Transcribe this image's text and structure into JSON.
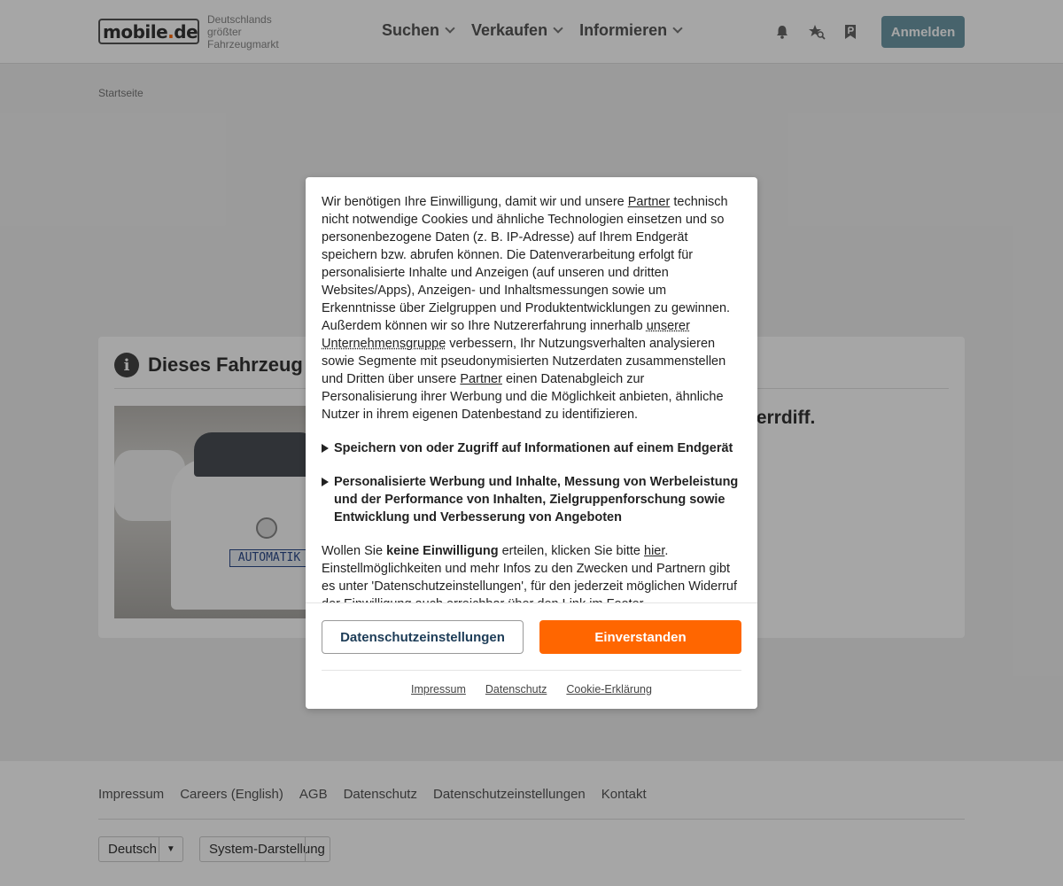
{
  "header": {
    "logo_text": "mobile",
    "logo_dot": ".",
    "logo_tld": "de",
    "slogan": "Deutschlands größter Fahrzeugmarkt",
    "nav": [
      {
        "label": "Suchen"
      },
      {
        "label": "Verkaufen"
      },
      {
        "label": "Informieren"
      }
    ],
    "login_label": "Anmelden",
    "accent_color": "#ff6600"
  },
  "breadcrumb": {
    "home": "Startseite"
  },
  "card": {
    "title": "Dieses Fahrzeug is",
    "model_fragment": "perrdiff.",
    "plate_text": "AUTOMATIK"
  },
  "footer": {
    "links": [
      "Impressum",
      "Careers (English)",
      "AGB",
      "Datenschutz",
      "Datenschutzeinstellungen",
      "Kontakt"
    ],
    "language": "Deutsch",
    "theme": "System-Darstellung"
  },
  "consent": {
    "intro_1": "Wir benötigen Ihre Einwilligung, damit wir und unsere ",
    "partner_link_1": "Partner",
    "intro_2": " technisch nicht notwendige Cookies und ähnliche Technologien einsetzen und so personenbezogene Daten (z. B. IP-Adresse) auf Ihrem Endgerät speichern bzw. abrufen können. Die Datenverarbeitung erfolgt für personalisierte Inhalte und Anzeigen (auf unseren und dritten Websites/Apps), Anzeigen- und Inhaltsmessungen sowie um Erkenntnisse über Zielgruppen und Produktentwicklungen zu gewinnen. Außerdem können wir so Ihre Nutzererfahrung innerhalb ",
    "group_link": "unserer Unternehmensgruppe",
    "intro_3": " verbessern, Ihr Nutzungsverhalten analysieren sowie Segmente mit pseudonymisierten Nutzerdaten zusammenstellen und Dritten über unsere ",
    "partner_link_2": "Partner",
    "intro_4": " einen Datenabgleich zur Personalisierung ihrer Werbung und die Möglichkeit anbieten, ähnliche Nutzer in ihrem eigenen Datenbestand zu identifizieren.",
    "purposes": [
      {
        "label": "Speichern von oder Zugriff auf Informationen auf einem Endgerät"
      },
      {
        "label": "Personalisierte Werbung und Inhalte, Messung von Werbeleistung und der Performance von Inhalten, Zielgruppenforschung sowie Entwicklung und Verbesserung von Angeboten"
      }
    ],
    "decline_1": "Wollen Sie ",
    "decline_bold": "keine Einwilligung",
    "decline_2": " erteilen, klicken Sie bitte ",
    "decline_link": "hier",
    "decline_3": ". Einstellmöglichkeiten und mehr Infos zu den Zwecken und Partnern gibt es unter 'Datenschutzeinstellungen', für den jederzeit möglichen Widerruf der Einwilligung auch erreichbar über den Link im Footer.",
    "settings_button": "Datenschutzeinstellungen",
    "accept_button": "Einverstanden",
    "links": [
      "Impressum",
      "Datenschutz",
      "Cookie-Erklärung"
    ]
  }
}
